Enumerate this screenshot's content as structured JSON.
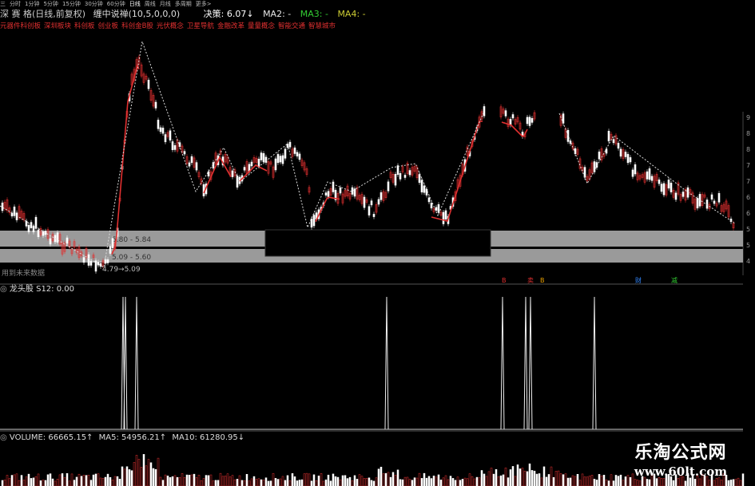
{
  "toolbar": {
    "items": [
      "三",
      "分时",
      "1分钟",
      "5分钟",
      "15分钟",
      "30分钟",
      "60分钟",
      "日线",
      "周线",
      "月线",
      "多周期",
      "更多>"
    ]
  },
  "header": {
    "stock_name": "深 赛 格(日线,前复权)",
    "indicator": "缠中说禅(10,5,0,0,0)",
    "decision": "决策: 6.07↓",
    "ma2": "MA2: -",
    "ma3": "MA3: -",
    "ma4": "MA4: -"
  },
  "concepts": [
    "元器件科创板",
    "深圳板块",
    "科创板",
    "创业板",
    "科创金B股",
    "光伏概念",
    "卫星导航",
    "金融改革",
    "量量概念",
    "智能交通",
    "智慧城市"
  ],
  "price_panel": {
    "band_upper": "5.80 - 5.84",
    "band_lower": "5.09 - 5.60",
    "low_label": "4.79→5.09",
    "future_data_label": "用到未来数据",
    "signal_labels": [
      {
        "text": "B",
        "color": "#e03030"
      },
      {
        "text": "卖",
        "color": "#e03030"
      },
      {
        "text": "B",
        "color": "#e8a000"
      },
      {
        "text": "财",
        "color": "#3388ff"
      },
      {
        "text": "减",
        "color": "#33cc33"
      }
    ],
    "right_axis_ticks": [
      "9",
      "8",
      "8",
      "7",
      "7",
      "6",
      "6",
      "5",
      "5",
      "4"
    ]
  },
  "dragon_panel": {
    "label": "龙头股 S12: 0.00"
  },
  "volume_panel": {
    "volume": "VOLUME: 66665.15↑",
    "ma5": "MA5: 54956.21↑",
    "ma10": "MA10: 61280.95↓"
  },
  "colors": {
    "up": "#e03030",
    "down": "#ffffff",
    "accent_red": "#e03030",
    "accent_green": "#33cc33"
  },
  "watermark": {
    "title": "乐淘公式网",
    "url": "www.60lt.com"
  }
}
